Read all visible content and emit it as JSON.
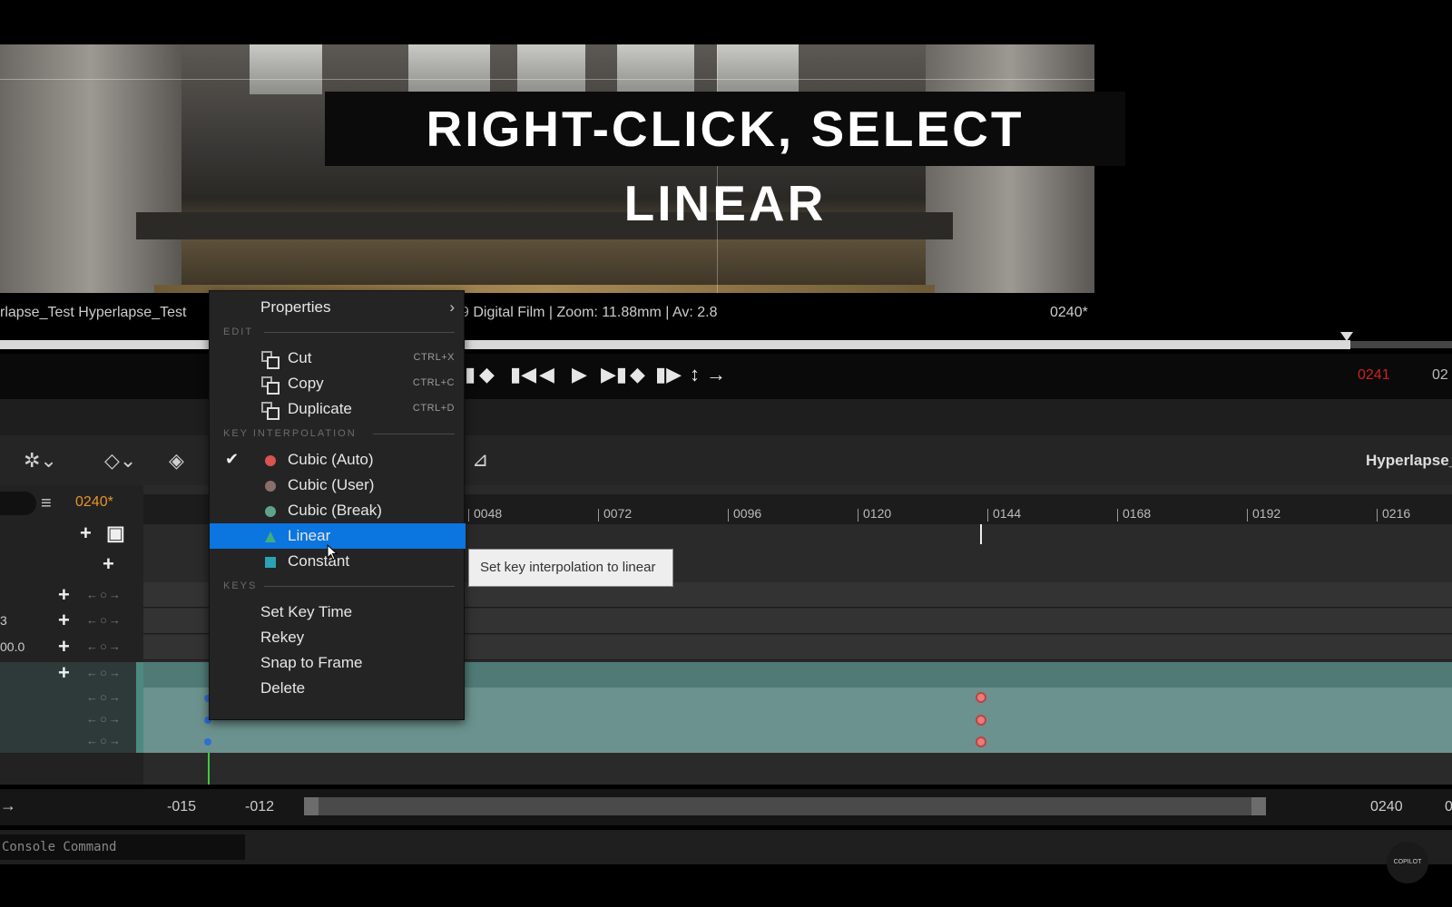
{
  "caption": "RIGHT-CLICK, SELECT LINEAR",
  "viewport_info": {
    "actor_names": "rlapse_Test Hyperlapse_Test",
    "camera_info": "9 Digital Film | Zoom: 11.88mm | Av: 2.8",
    "frame": "0240*"
  },
  "transport": {
    "current_frame_red": "0241",
    "end_frame": "02"
  },
  "toolbar": {
    "sequence_name": "Hyperlapse_T",
    "current_frame": "0240*"
  },
  "left_panel": {
    "values": [
      "3",
      "00.0"
    ]
  },
  "ruler": {
    "labels": [
      "0048",
      "0072",
      "0096",
      "0120",
      "0144",
      "0168",
      "0192",
      "0216"
    ]
  },
  "range": {
    "start_a": "-015",
    "start_b": "-012",
    "end": "0240",
    "end_cut": "0"
  },
  "console": {
    "placeholder": "Console Command"
  },
  "context_menu": {
    "properties": "Properties",
    "edit_header": "EDIT",
    "cut": "Cut",
    "cut_shortcut": "CTRL+X",
    "copy": "Copy",
    "copy_shortcut": "CTRL+C",
    "duplicate": "Duplicate",
    "duplicate_shortcut": "CTRL+D",
    "interp_header": "KEY INTERPOLATION",
    "cubic_auto": "Cubic (Auto)",
    "cubic_user": "Cubic (User)",
    "cubic_break": "Cubic (Break)",
    "linear": "Linear",
    "constant": "Constant",
    "keys_header": "KEYS",
    "set_key_time": "Set Key Time",
    "rekey": "Rekey",
    "snap_to_frame": "Snap to Frame",
    "delete": "Delete"
  },
  "tooltip": "Set key interpolation to linear",
  "watermark": "COPILOT",
  "colors": {
    "highlight": "#0b75e0",
    "cubic_auto": "#d9534f",
    "cubic_user": "#8a6e6e",
    "cubic_break": "#5fa38a",
    "linear": "#3fae7f",
    "constant": "#2aa3b5",
    "frame_orange": "#e8922a"
  },
  "icons": [
    "check-icon",
    "chevron-right-icon",
    "cut-icon",
    "copy-icon",
    "duplicate-icon",
    "play-icon",
    "filter-icon",
    "plus-icon",
    "camera-icon",
    "key-icon"
  ]
}
